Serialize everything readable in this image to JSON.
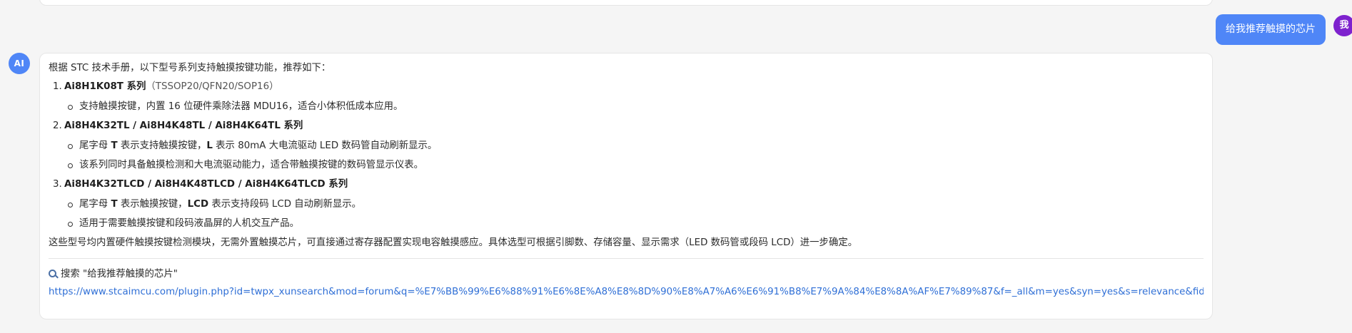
{
  "user_message": {
    "avatar_label": "我",
    "text": "给我推荐触摸的芯片"
  },
  "ai_message": {
    "avatar_label": "AI",
    "intro": "根据 STC 技术手册，以下型号系列支持触摸按键功能，推荐如下：",
    "items": [
      {
        "num": "1.",
        "title": "Ai8H1K08T 系列",
        "suffix": "（TSSOP20/QFN20/SOP16）",
        "bullets": [
          {
            "parts": [
              "支持触摸按键，内置 16 位硬件乘除法器 MDU16，适合小体积低成本应用。"
            ]
          }
        ]
      },
      {
        "num": "2.",
        "title": "Ai8H4K32TL / Ai8H4K48TL / Ai8H4K64TL 系列",
        "suffix": "",
        "bullets": [
          {
            "pre": "尾字母 ",
            "b1": "T",
            "mid": " 表示支持触摸按键，",
            "b2": "L",
            "post": " 表示 80mA 大电流驱动 LED 数码管自动刷新显示。"
          },
          {
            "text": "该系列同时具备触摸检测和大电流驱动能力，适合带触摸按键的数码管显示仪表。"
          }
        ]
      },
      {
        "num": "3.",
        "title": "Ai8H4K32TLCD / Ai8H4K48TLCD / Ai8H4K64TLCD 系列",
        "suffix": "",
        "bullets": [
          {
            "pre": "尾字母 ",
            "b1": "T",
            "mid": " 表示触摸按键，",
            "b2": "LCD",
            "post": " 表示支持段码 LCD 自动刷新显示。"
          },
          {
            "text": "适用于需要触摸按键和段码液晶屏的人机交互产品。"
          }
        ]
      }
    ],
    "summary": "这些型号均内置硬件触摸按键检测模块，无需外置触摸芯片，可直接通过寄存器配置实现电容触摸感应。具体选型可根据引脚数、存储容量、显示需求（LED 数码管或段码 LCD）进一步确定。",
    "search_label": "搜索 \"给我推荐触摸的芯片\"",
    "search_url": "https://www.stcaimcu.com/plugin.php?id=twpx_xunsearch&mod=forum&q=%E7%BB%99%E6%88%91%E6%8E%A8%E8%8D%90%E8%A7%A6%E6%91%B8%E7%9A%84%E8%8A%AF%E7%89%87&f=_all&m=yes&syn=yes&s=relevance&fid=0"
  },
  "colors": {
    "user_bubble": "#4f86f7",
    "user_avatar": "#7e22ce",
    "ai_avatar": "#4f86f7",
    "link": "#2f6fd6"
  }
}
